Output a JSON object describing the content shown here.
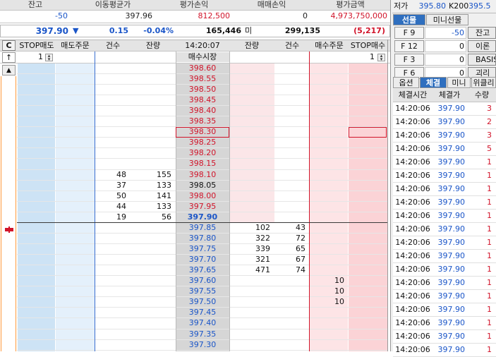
{
  "summary": {
    "labels": [
      "잔고",
      "이동평균가",
      "평가손익",
      "매매손익",
      "평가금액"
    ],
    "values": [
      "-50",
      "397.96",
      "812,500",
      "0",
      "4,973,750,000"
    ]
  },
  "price_bar": {
    "price": "397.90",
    "arrow": "▼",
    "change": "0.15",
    "rate": "-0.04%",
    "volume": "165,446",
    "mi": "미",
    "open_interest": "299,135",
    "oi_change": "(5,217)"
  },
  "grid": {
    "c_button": "C",
    "headers": [
      "STOP매도",
      "매도주문",
      "건수",
      "잔량",
      "14:20:07",
      "잔량",
      "건수",
      "매수주문",
      "STOP매수"
    ],
    "market_label": "매수시장",
    "left_qty": "1",
    "right_qty": "1",
    "up_marker": "↑",
    "up_button": "▲",
    "ask_prices": [
      "398.60",
      "398.55",
      "398.50",
      "398.45",
      "398.40",
      "398.35",
      "398.30",
      "398.25",
      "398.20",
      "398.15",
      "398.10",
      "398.05",
      "398.00",
      "397.95",
      "397.90"
    ],
    "ask_counts": [
      "",
      "",
      "",
      "",
      "",
      "",
      "",
      "",
      "",
      "",
      "48",
      "37",
      "50",
      "44",
      "19"
    ],
    "ask_remains": [
      "",
      "",
      "",
      "",
      "",
      "",
      "",
      "",
      "",
      "",
      "155",
      "133",
      "141",
      "133",
      "56"
    ],
    "bid_prices": [
      "397.85",
      "397.80",
      "397.75",
      "397.70",
      "397.65",
      "397.60",
      "397.55",
      "397.50",
      "397.45",
      "397.40",
      "397.35",
      "397.30"
    ],
    "bid_remains": [
      "102",
      "322",
      "339",
      "321",
      "471",
      "",
      "",
      "",
      "",
      "",
      "",
      ""
    ],
    "bid_counts": [
      "43",
      "72",
      "65",
      "67",
      "74",
      "",
      "",
      "",
      "",
      "",
      "",
      ""
    ],
    "buy_orders": [
      "",
      "",
      "",
      "",
      "",
      "10",
      "10",
      "10",
      "",
      "",
      "",
      ""
    ]
  },
  "right_panel": {
    "low_label": "저가",
    "low_value": "395.80",
    "k200_label": "K200",
    "k200_value": "395.5",
    "tabs_top": [
      "선물",
      "미니선물"
    ],
    "fkeys": [
      {
        "key": "F 9",
        "value": "-50",
        "button": "잔고"
      },
      {
        "key": "F 12",
        "value": "0",
        "button": "이론가"
      },
      {
        "key": "F 3",
        "value": "0",
        "button": "BASIS"
      },
      {
        "key": "F 6",
        "value": "0",
        "button": "괴리율"
      }
    ],
    "tabs_bottom": [
      "옵션",
      "체결",
      "미니",
      "위클리"
    ],
    "trade_headers": [
      "체결시간",
      "체결가",
      "수량"
    ],
    "trades": [
      {
        "time": "14:20:06",
        "price": "397.90",
        "qty": "3",
        "color": "red"
      },
      {
        "time": "14:20:06",
        "price": "397.90",
        "qty": "2",
        "color": "red"
      },
      {
        "time": "14:20:06",
        "price": "397.90",
        "qty": "3",
        "color": "red"
      },
      {
        "time": "14:20:06",
        "price": "397.90",
        "qty": "5",
        "color": "red"
      },
      {
        "time": "14:20:06",
        "price": "397.90",
        "qty": "1",
        "color": "red"
      },
      {
        "time": "14:20:06",
        "price": "397.90",
        "qty": "1",
        "color": "red"
      },
      {
        "time": "14:20:06",
        "price": "397.90",
        "qty": "1",
        "color": "red"
      },
      {
        "time": "14:20:06",
        "price": "397.90",
        "qty": "1",
        "color": "red"
      },
      {
        "time": "14:20:06",
        "price": "397.90",
        "qty": "1",
        "color": "red"
      },
      {
        "time": "14:20:06",
        "price": "397.90",
        "qty": "1",
        "color": "red"
      },
      {
        "time": "14:20:06",
        "price": "397.90",
        "qty": "1",
        "color": "red"
      },
      {
        "time": "14:20:06",
        "price": "397.90",
        "qty": "1",
        "color": "red"
      },
      {
        "time": "14:20:06",
        "price": "397.90",
        "qty": "1",
        "color": "red"
      },
      {
        "time": "14:20:06",
        "price": "397.90",
        "qty": "1",
        "color": "red"
      },
      {
        "time": "14:20:06",
        "price": "397.90",
        "qty": "1",
        "color": "red"
      },
      {
        "time": "14:20:06",
        "price": "397.90",
        "qty": "1",
        "color": "red"
      },
      {
        "time": "14:20:06",
        "price": "397.90",
        "qty": "1",
        "color": "red"
      },
      {
        "time": "14:20:06",
        "price": "397.90",
        "qty": "1",
        "color": "red"
      },
      {
        "time": "14:20:06",
        "price": "397.90",
        "qty": "1",
        "color": "red"
      }
    ]
  },
  "colors": {
    "ask_price": "#d1142a",
    "bid_price": "#1a55c8",
    "sell_col": "#cde3f5",
    "buy_col": "#fbd3d6"
  }
}
